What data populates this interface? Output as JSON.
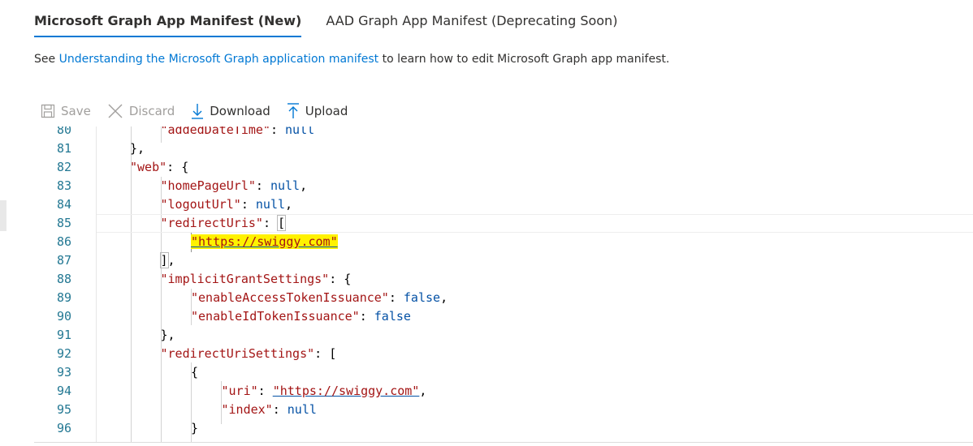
{
  "tabs": [
    {
      "label": "Microsoft Graph App Manifest (New)",
      "active": true
    },
    {
      "label": "AAD Graph App Manifest (Deprecating Soon)",
      "active": false
    }
  ],
  "intro": {
    "prefix": "See ",
    "link_text": "Understanding the Microsoft Graph application manifest",
    "suffix": " to learn how to edit Microsoft Graph app manifest."
  },
  "toolbar": {
    "save_label": "Save",
    "discard_label": "Discard",
    "download_label": "Download",
    "upload_label": "Upload"
  },
  "editor": {
    "lines": [
      {
        "n": "80",
        "indent": 2,
        "key": "\"addedDateTime\"",
        "sep": ": ",
        "value": "null",
        "tail": ""
      },
      {
        "n": "81",
        "indent": 1,
        "text": "},"
      },
      {
        "n": "82",
        "indent": 1,
        "key": "\"web\"",
        "sep": ": ",
        "tail": "{"
      },
      {
        "n": "83",
        "indent": 2,
        "key": "\"homePageUrl\"",
        "sep": ": ",
        "value": "null",
        "tail": ","
      },
      {
        "n": "84",
        "indent": 2,
        "key": "\"logoutUrl\"",
        "sep": ": ",
        "value": "null",
        "tail": ","
      },
      {
        "n": "85",
        "indent": 2,
        "key": "\"redirectUris\"",
        "sep": ": ",
        "bracket": "["
      },
      {
        "n": "86",
        "indent": 3,
        "string": "\"https://swiggy.com\"",
        "highlighted": true
      },
      {
        "n": "87",
        "indent": 2,
        "bracket": "]",
        "tail": ","
      },
      {
        "n": "88",
        "indent": 2,
        "key": "\"implicitGrantSettings\"",
        "sep": ": ",
        "tail": "{"
      },
      {
        "n": "89",
        "indent": 3,
        "key": "\"enableAccessTokenIssuance\"",
        "sep": ": ",
        "value": "false",
        "tail": ","
      },
      {
        "n": "90",
        "indent": 3,
        "key": "\"enableIdTokenIssuance\"",
        "sep": ": ",
        "value": "false",
        "tail": ""
      },
      {
        "n": "91",
        "indent": 2,
        "text": "},"
      },
      {
        "n": "92",
        "indent": 2,
        "key": "\"redirectUriSettings\"",
        "sep": ": ",
        "tail": "["
      },
      {
        "n": "93",
        "indent": 3,
        "text": "{"
      },
      {
        "n": "94",
        "indent": 4,
        "key": "\"uri\"",
        "sep": ": ",
        "string": "\"https://swiggy.com\"",
        "tail": ","
      },
      {
        "n": "95",
        "indent": 4,
        "key": "\"index\"",
        "sep": ": ",
        "value": "null",
        "tail": ""
      },
      {
        "n": "96",
        "indent": 3,
        "text": "}"
      }
    ],
    "current_line": "85",
    "colors": {
      "key": "#a31515",
      "value": "#0451a5",
      "line_number": "#237893",
      "highlight": "#fff200",
      "accent": "#0078d4"
    }
  }
}
